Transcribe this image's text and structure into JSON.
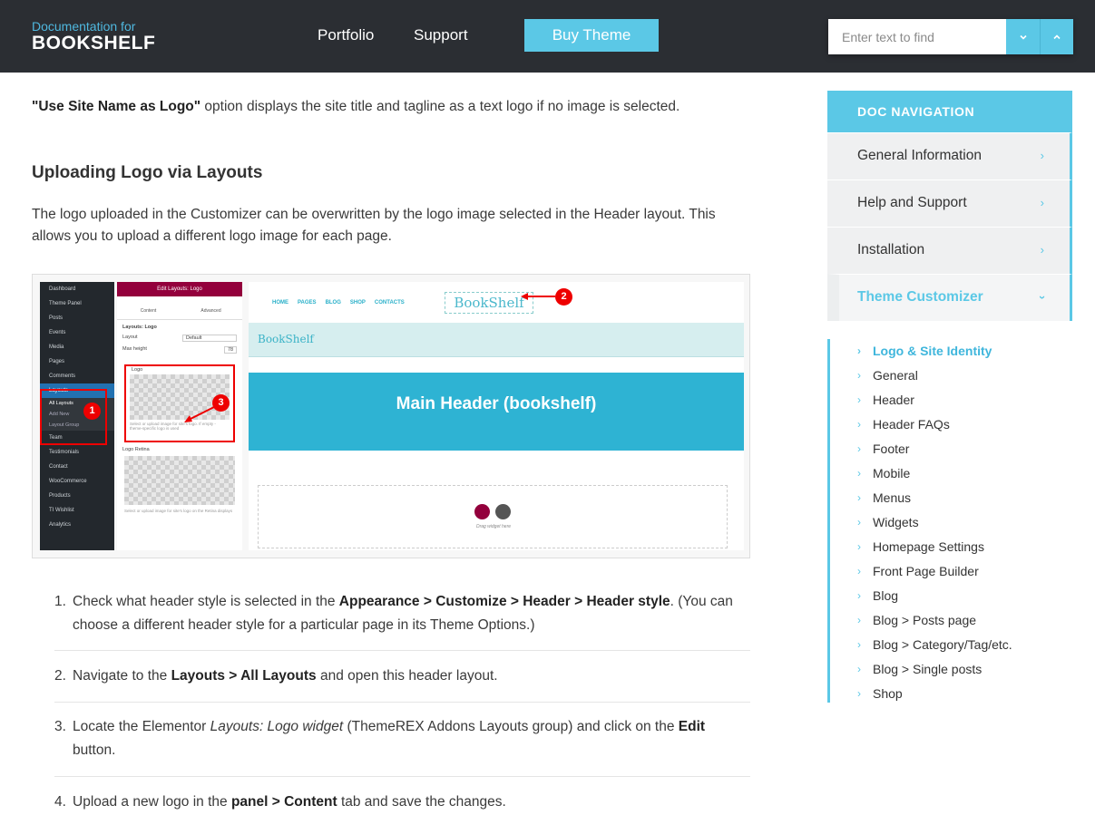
{
  "header": {
    "brand_small": "Documentation for",
    "brand_big": "BOOKSHELF",
    "nav": [
      {
        "label": "Portfolio"
      },
      {
        "label": "Support"
      },
      {
        "label": "Buy Theme"
      }
    ],
    "search": {
      "placeholder": "Enter text to find",
      "prev_icon": "chevron-down-icon",
      "next_icon": "chevron-up-icon"
    }
  },
  "content": {
    "intro_bold": "\"Use Site Name as Logo\"",
    "intro_rest": " option displays the site title and tagline as a text logo if no image is selected.",
    "heading": "Uploading Logo via Layouts",
    "paragraph": "The logo uploaded in the Customizer can be overwritten by the logo image selected in the Header layout. This allows you to upload a different logo image for each page.",
    "figure": {
      "wp_menu": [
        "Dashboard",
        "Theme Panel",
        "Posts",
        "Events",
        "Media",
        "Pages",
        "Comments",
        "Layouts"
      ],
      "wp_submenu": [
        "All Layouts",
        "Add New",
        "Layout Group"
      ],
      "wp_menu_after": [
        "Team",
        "Testimonials",
        "Contact",
        "WooCommerce",
        "Products",
        "TI Wishlist",
        "Analytics"
      ],
      "panel_title": "Edit Layouts: Logo",
      "panel_tabs": [
        "Content",
        "Advanced"
      ],
      "panel_section": "Layouts: Logo",
      "panel_layout_label": "Layout",
      "panel_layout_value": "Default",
      "panel_maxheight_label": "Max height",
      "panel_maxheight_value": "78",
      "panel_logo_label": "Logo",
      "panel_logo_note": "Select or upload image for site's logo. If empty - theme-specific logo is used",
      "panel_retina_label": "Logo Retina",
      "panel_retina_note": "Select or upload image for site's logo on the Retina displays",
      "preview_nav": [
        "HOME",
        "PAGES",
        "BLOG",
        "SHOP",
        "CONTACTS"
      ],
      "preview_logo": "BookShelf",
      "preview_bar_logo": "BookShelf",
      "banner_title": "Main Header (bookshelf)",
      "drop_text": "Drag widget here",
      "badges": [
        "1",
        "2",
        "3"
      ]
    },
    "steps": [
      {
        "num": "1.",
        "parts": [
          {
            "t": "Check what header style is selected in the "
          },
          {
            "b": "Appearance > Customize > Header > Header style"
          },
          {
            "t": ". (You can choose a different header style for a particular page in its Theme Options.)"
          }
        ]
      },
      {
        "num": "2.",
        "parts": [
          {
            "t": "Navigate to the "
          },
          {
            "b": "Layouts > All Layouts"
          },
          {
            "t": " and open this header layout."
          }
        ]
      },
      {
        "num": "3.",
        "parts": [
          {
            "t": "Locate the Elementor "
          },
          {
            "i": "Layouts: Logo widget"
          },
          {
            "t": " (ThemeREX Addons Layouts group) and click on the "
          },
          {
            "b": "Edit"
          },
          {
            "t": " button."
          }
        ]
      },
      {
        "num": "4.",
        "parts": [
          {
            "t": "Upload a new logo in the "
          },
          {
            "b": "panel > Content"
          },
          {
            "t": " tab and save the changes."
          }
        ]
      }
    ]
  },
  "docnav": {
    "title": "DOC NAVIGATION",
    "sections": [
      {
        "label": "General Information"
      },
      {
        "label": "Help and Support"
      },
      {
        "label": "Installation"
      },
      {
        "label": "Theme Customizer"
      }
    ],
    "subitems": [
      "Logo & Site Identity",
      "General",
      "Header",
      "Header FAQs",
      "Footer",
      "Mobile",
      "Menus",
      "Widgets",
      "Homepage Settings",
      "Front Page Builder",
      "Blog",
      "Blog > Posts page",
      "Blog > Category/Tag/etc.",
      "Blog > Single posts",
      "Shop"
    ],
    "accent": "#5bc8e6"
  }
}
